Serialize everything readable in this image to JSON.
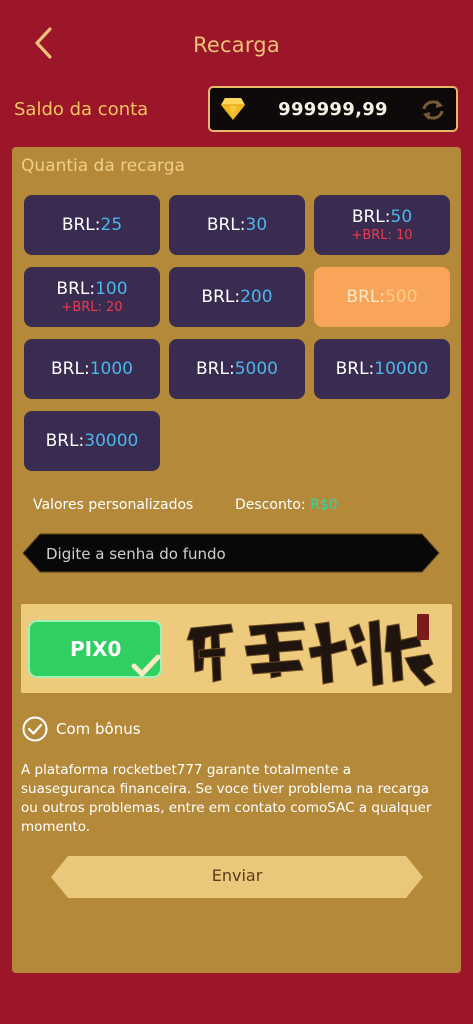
{
  "header": {
    "title": "Recarga",
    "back_icon": "chevron-left-icon"
  },
  "balance": {
    "label": "Saldo da conta",
    "value": "999999,99",
    "gem_icon": "diamond-icon",
    "refresh_icon": "refresh-icon"
  },
  "recharge": {
    "title": "Quantia da recarga",
    "amounts": [
      {
        "currency": "BRL:",
        "value": "25",
        "bonus": ""
      },
      {
        "currency": "BRL:",
        "value": "30",
        "bonus": ""
      },
      {
        "currency": "BRL:",
        "value": "50",
        "bonus": "+BRL: 10"
      },
      {
        "currency": "BRL:",
        "value": "100",
        "bonus": "+BRL: 20"
      },
      {
        "currency": "BRL:",
        "value": "200",
        "bonus": ""
      },
      {
        "currency": "BRL:",
        "value": "500",
        "bonus": "",
        "selected": true
      },
      {
        "currency": "BRL:",
        "value": "1000",
        "bonus": ""
      },
      {
        "currency": "BRL:",
        "value": "5000",
        "bonus": ""
      },
      {
        "currency": "BRL:",
        "value": "10000",
        "bonus": ""
      },
      {
        "currency": "BRL:",
        "value": "30000",
        "bonus": ""
      }
    ],
    "custom_label": "Valores personalizados",
    "discount_label": "Desconto:",
    "discount_value": "R$0",
    "password_placeholder": "Digite a senha do fundo"
  },
  "payment": {
    "method_label": "PIX0",
    "logo_name": "nanwu-tech-logo"
  },
  "bonus_option": {
    "label": "Com bônus",
    "checked": true
  },
  "notice": "A plataforma rocketbet777 garante totalmente a suaseguranca financeira. Se voce tiver problema na recarga ou outros problemas, entre em contato comoSAC a qualquer momento.",
  "submit_label": "Enviar",
  "colors": {
    "background": "#9a1628",
    "panel": "#b48a3a",
    "button": "#3a2c50",
    "selected": "#f8a55a",
    "accent_blue": "#4ab5ee",
    "bonus_red": "#ee3a4a",
    "gold": "#eec07a"
  }
}
